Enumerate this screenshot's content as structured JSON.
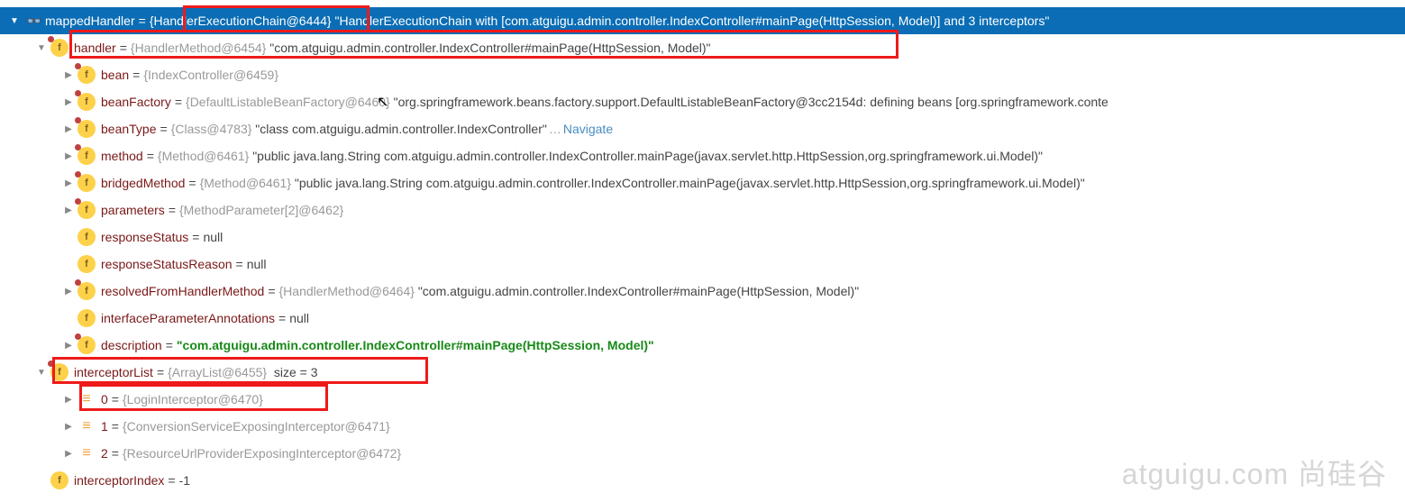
{
  "root": {
    "name": "mappedHandler",
    "type": "{HandlerExecutionChain@6444}",
    "value": "\"HandlerExecutionChain with [com.atguigu.admin.controller.IndexController#mainPage(HttpSession, Model)] and 3 interceptors\""
  },
  "handler": {
    "name": "handler",
    "type": "{HandlerMethod@6454}",
    "value": "\"com.atguigu.admin.controller.IndexController#mainPage(HttpSession, Model)\""
  },
  "fields": {
    "bean": {
      "name": "bean",
      "type": "{IndexController@6459}",
      "value": ""
    },
    "beanFactory": {
      "name": "beanFactory",
      "type": "{DefaultListableBeanFactory@6460}",
      "value": "\"org.springframework.beans.factory.support.DefaultListableBeanFactory@3cc2154d: defining beans [org.springframework.conte"
    },
    "beanType": {
      "name": "beanType",
      "type": "{Class@4783}",
      "value": "\"class com.atguigu.admin.controller.IndexController\"",
      "navigate": "Navigate"
    },
    "method": {
      "name": "method",
      "type": "{Method@6461}",
      "value": "\"public java.lang.String com.atguigu.admin.controller.IndexController.mainPage(javax.servlet.http.HttpSession,org.springframework.ui.Model)\""
    },
    "bridgedMethod": {
      "name": "bridgedMethod",
      "type": "{Method@6461}",
      "value": "\"public java.lang.String com.atguigu.admin.controller.IndexController.mainPage(javax.servlet.http.HttpSession,org.springframework.ui.Model)\""
    },
    "parameters": {
      "name": "parameters",
      "type": "{MethodParameter[2]@6462}",
      "value": ""
    },
    "responseStatus": {
      "name": "responseStatus",
      "value": "null"
    },
    "responseStatusReason": {
      "name": "responseStatusReason",
      "value": "null"
    },
    "resolvedFromHandlerMethod": {
      "name": "resolvedFromHandlerMethod",
      "type": "{HandlerMethod@6464}",
      "value": "\"com.atguigu.admin.controller.IndexController#mainPage(HttpSession, Model)\""
    },
    "interfaceParameterAnnotations": {
      "name": "interfaceParameterAnnotations",
      "value": "null"
    },
    "description": {
      "name": "description",
      "value": "\"com.atguigu.admin.controller.IndexController#mainPage(HttpSession, Model)\""
    }
  },
  "interceptorList": {
    "name": "interceptorList",
    "type": "{ArrayList@6455}",
    "size": "size = 3",
    "items": [
      {
        "idx": "0",
        "type": "{LoginInterceptor@6470}"
      },
      {
        "idx": "1",
        "type": "{ConversionServiceExposingInterceptor@6471}"
      },
      {
        "idx": "2",
        "type": "{ResourceUrlProviderExposingInterceptor@6472}"
      }
    ]
  },
  "interceptorIndex": {
    "name": "interceptorIndex",
    "value": "-1"
  },
  "watermark": "atguigu.com 尚硅谷"
}
